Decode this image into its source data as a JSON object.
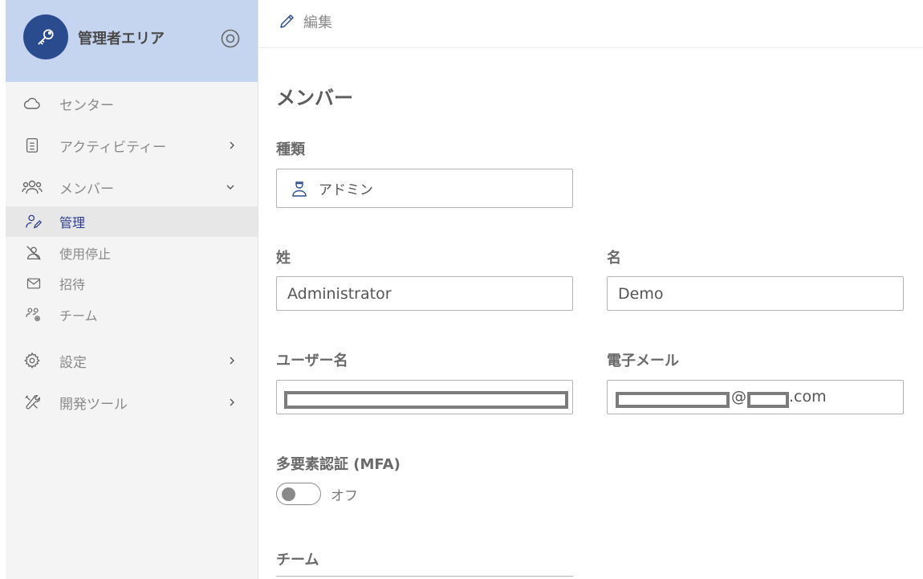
{
  "sidebar": {
    "title": "管理者エリア",
    "items": [
      {
        "label": "センター"
      },
      {
        "label": "アクティビティー"
      },
      {
        "label": "メンバー"
      },
      {
        "label": "設定"
      },
      {
        "label": "開発ツール"
      }
    ],
    "sub_items": [
      {
        "label": "管理"
      },
      {
        "label": "使用停止"
      },
      {
        "label": "招待"
      },
      {
        "label": "チーム"
      }
    ]
  },
  "topbar": {
    "edit_label": "編集"
  },
  "main": {
    "title": "メンバー",
    "type_label": "種類",
    "type_value": "アドミン",
    "last_name_label": "姓",
    "last_name_value": "Administrator",
    "first_name_label": "名",
    "first_name_value": "Demo",
    "username_label": "ユーザー名",
    "email_label": "電子メール",
    "email_at": "@",
    "email_tld": ".com",
    "mfa_label": "多要素認証 (MFA)",
    "mfa_state": "オフ",
    "team_label": "チーム"
  },
  "colors": {
    "accent": "#2a4c8f",
    "header_bg": "#c5d5ef",
    "active_text": "#2d3d8f"
  }
}
